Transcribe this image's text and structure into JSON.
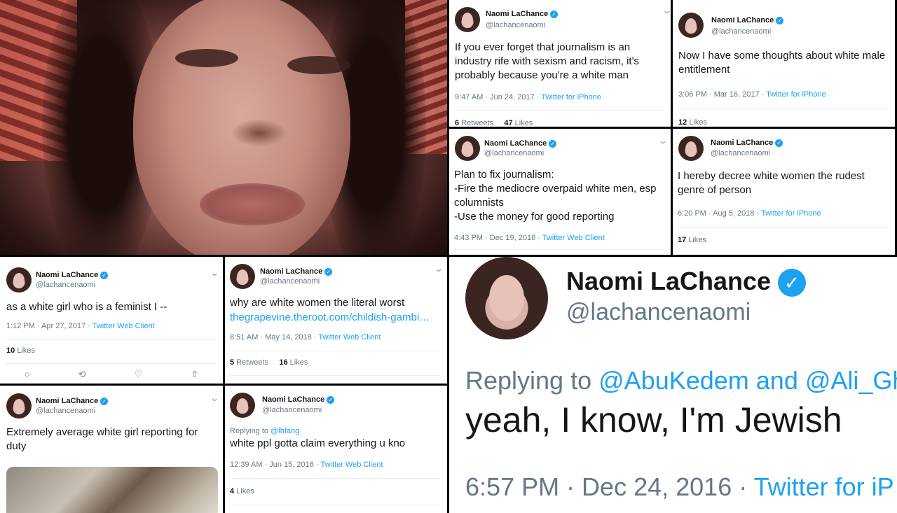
{
  "user": {
    "name": "Naomi LaChance",
    "handle": "@lachancenaomi",
    "verified_glyph": "✓"
  },
  "tweets": [
    {
      "text": "If you ever forget that journalism is an industry rife with sexism and racism, it's probably because you're a white man",
      "time": "9:47 AM · Jun 24, 2017 · ",
      "source": "Twitter for iPhone",
      "retweets_n": "6",
      "retweets_l": "Retweets",
      "likes_n": "47",
      "likes_l": "Likes"
    },
    {
      "text": "Now I have some thoughts about white male entitlement",
      "time": "3:06 PM · Mar 16, 2017 · ",
      "source": "Twitter for iPhone",
      "likes_n": "12",
      "likes_l": "Likes"
    },
    {
      "text": "Plan to fix journalism:\n-Fire the mediocre overpaid white men, esp columnists\n-Use the money for good reporting",
      "time": "4:43 PM · Dec 19, 2016 · ",
      "source": "Twitter Web Client"
    },
    {
      "text": "I hereby decree white women the rudest genre of person",
      "time": "6:20 PM · Aug 5, 2018 · ",
      "source": "Twitter for iPhone",
      "likes_n": "17",
      "likes_l": "Likes"
    },
    {
      "text": "as a white girl who is a feminist I --",
      "time": "1:12 PM · Apr 27, 2017 · ",
      "source": "Twitter Web Client",
      "likes_n": "10",
      "likes_l": "Likes"
    },
    {
      "text": "why are white women the literal worst",
      "link": "thegrapevine.theroot.com/childish-gambi…",
      "time": "8:51 AM · May 14, 2018 · ",
      "source": "Twitter Web Client",
      "retweets_n": "5",
      "retweets_l": "Retweets",
      "likes_n": "16",
      "likes_l": "Likes"
    },
    {
      "text": "Extremely average white girl reporting for duty"
    },
    {
      "reply_label": "Replying to ",
      "reply_to": "@lhfang",
      "text": "white ppl gotta claim everything u kno",
      "time": "12:39 AM · Jun 15, 2016 · ",
      "source": "Twitter Web Client",
      "likes_n": "4",
      "likes_l": "Likes"
    }
  ],
  "big": {
    "reply_label": "Replying to ",
    "reply_to": "@AbuKedem and @Ali_Gh",
    "text": "yeah, I know, I'm Jewish",
    "time": "6:57 PM · Dec 24, 2016 · ",
    "source": "Twitter for iP"
  },
  "icons": {
    "chevron": "⌄",
    "reply": "○",
    "retweet": "⟲",
    "like": "♡",
    "share": "⇧"
  }
}
